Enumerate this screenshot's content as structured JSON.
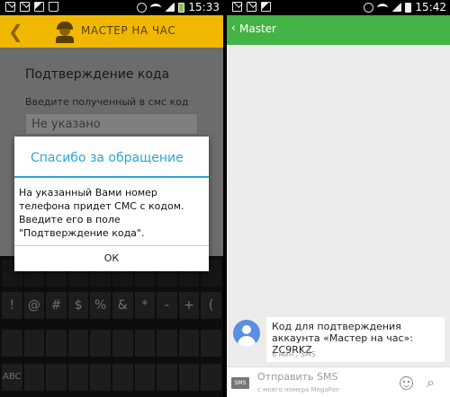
{
  "left": {
    "status_time": "15:33",
    "app_title": "МАСТЕР НА ЧАС",
    "heading": "Подтверждение кода",
    "prompt": "Введите полученный в смс код",
    "input_placeholder": "Не указано",
    "dialog": {
      "title": "Спасибо за обращение",
      "body": "На указанный Вами номер телефона придет СМС с кодом. Введите его в поле \"Подтверждение кода\".",
      "ok": "ОК"
    },
    "keyboard": {
      "rows": [
        [
          "",
          "",
          "",
          "",
          "",
          "",
          "",
          "",
          "",
          ""
        ],
        [
          "!",
          "@",
          "#",
          "$",
          "%",
          "&",
          "*",
          "-",
          "+",
          "("
        ],
        [
          "",
          "",
          "",
          "",
          "",
          "",
          "",
          "",
          "",
          ""
        ],
        [
          "ABC",
          "",
          "",
          "",
          "",
          "",
          "",
          "",
          "",
          ""
        ]
      ]
    }
  },
  "right": {
    "status_time": "15:42",
    "title": "Master",
    "message": {
      "text": "Код для подтверждения аккаунта «Мастер на час»: ZC9RKZ",
      "meta": "8 мин., SMS"
    },
    "compose": {
      "placeholder": "Отправить SMS",
      "subline": "с моего номера MegaFon",
      "sms_label": "SMS"
    }
  },
  "colors": {
    "accent_yellow": "#f0b800",
    "dialog_blue": "#29a7d8",
    "green": "#43b346"
  }
}
